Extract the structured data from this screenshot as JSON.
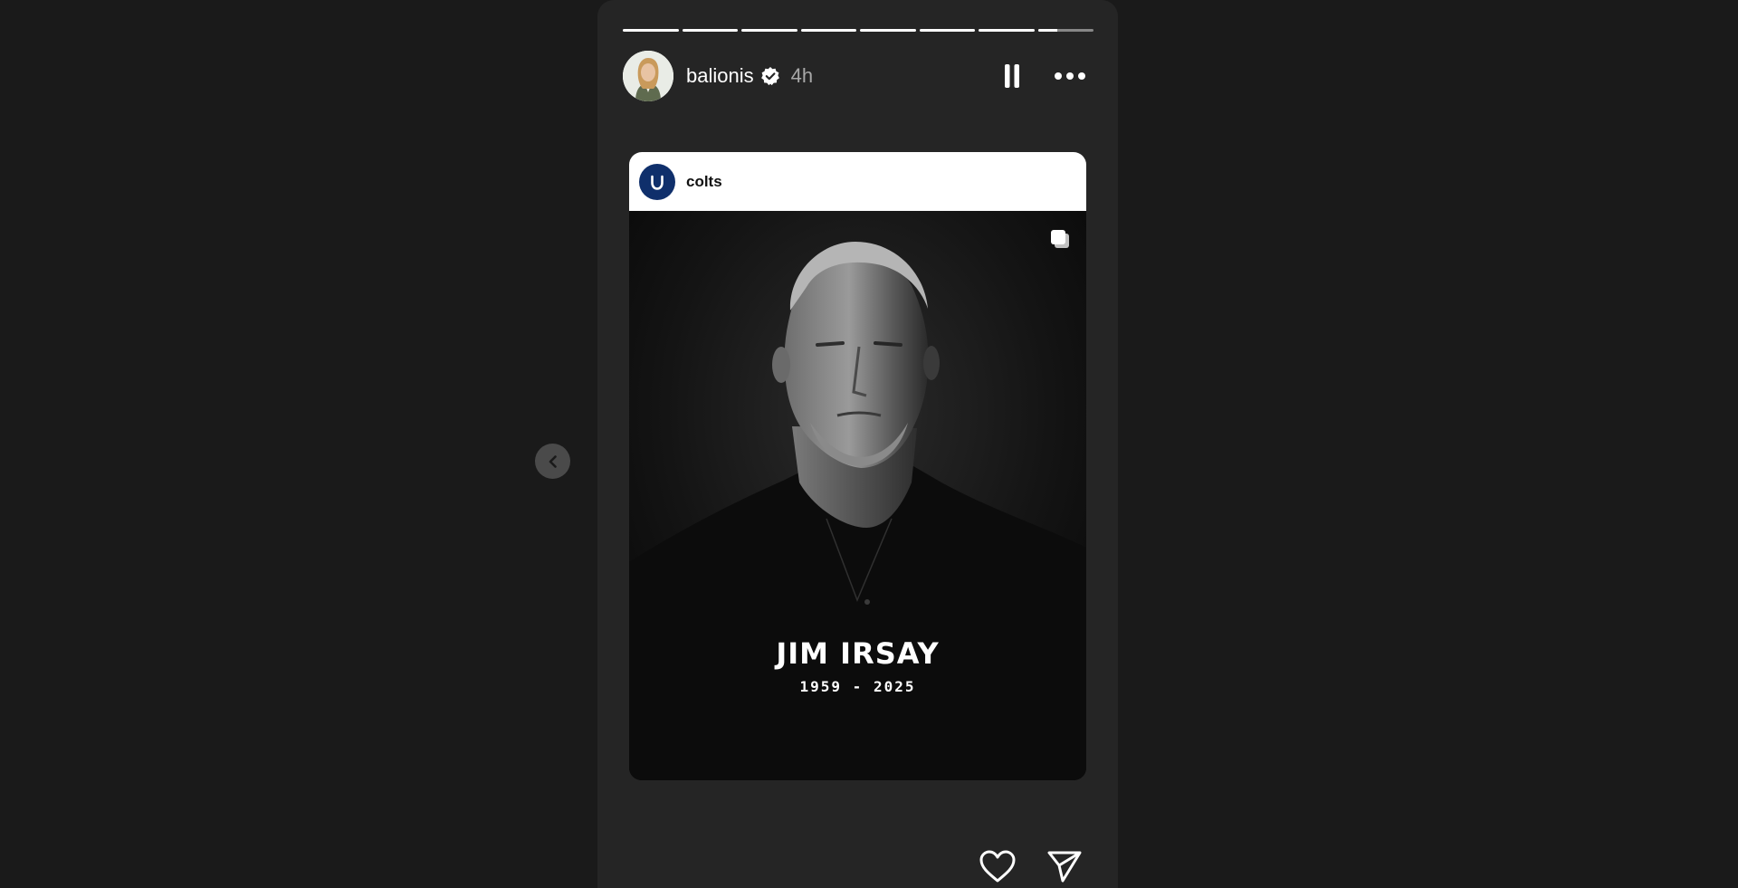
{
  "story": {
    "progress_segments": [
      1,
      1,
      1,
      1,
      1,
      1,
      1,
      0.35
    ],
    "author": {
      "username": "balionis",
      "verified": true,
      "timestamp": "4h",
      "avatar_icon": "profile-photo"
    },
    "controls": {
      "pause_icon": "pause-icon",
      "more_icon": "more-options-icon"
    },
    "shared_post": {
      "account": "colts",
      "account_icon": "colts-horseshoe-logo",
      "multi_image_icon": "carousel-icon",
      "caption_name": "JIM IRSAY",
      "caption_years": "1959 - 2025"
    },
    "footer": {
      "like_icon": "heart-icon",
      "share_icon": "send-icon"
    },
    "navigation": {
      "prev_icon": "chevron-left-icon"
    }
  },
  "colors": {
    "background": "#1a1a1a",
    "story_panel": "#252525",
    "colts_blue": "#0f2f6b"
  }
}
